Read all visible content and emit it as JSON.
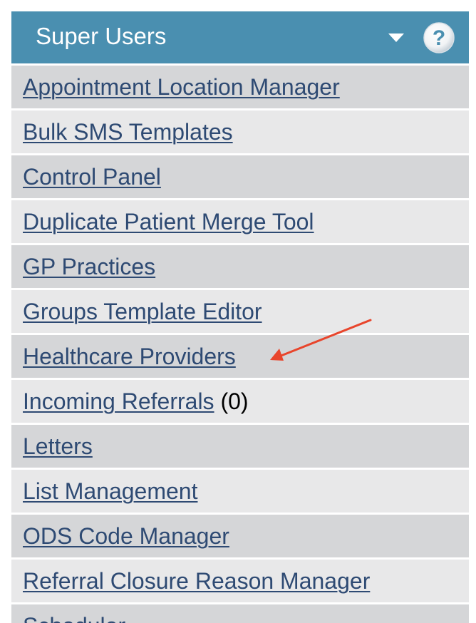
{
  "panel": {
    "title": "Super Users",
    "dropdown_icon": "caret-down-icon",
    "help_icon": "question-mark-icon",
    "help_symbol": "?",
    "header_color": "#4a8fb0",
    "link_color": "#2e4a73"
  },
  "menu": {
    "items": [
      {
        "label": "Appointment Location Manager"
      },
      {
        "label": "Bulk SMS Templates"
      },
      {
        "label": "Control Panel"
      },
      {
        "label": "Duplicate Patient Merge Tool"
      },
      {
        "label": "GP Practices"
      },
      {
        "label": "Groups Template Editor"
      },
      {
        "label": "Healthcare Providers"
      },
      {
        "label": "Incoming Referrals",
        "count": "(0)"
      },
      {
        "label": "Letters"
      },
      {
        "label": "List Management"
      },
      {
        "label": "ODS Code Manager"
      },
      {
        "label": "Referral Closure Reason Manager"
      },
      {
        "label": "Scheduler"
      }
    ]
  },
  "annotation": {
    "arrow_color": "#e8452c",
    "points_to": "Healthcare Providers"
  }
}
